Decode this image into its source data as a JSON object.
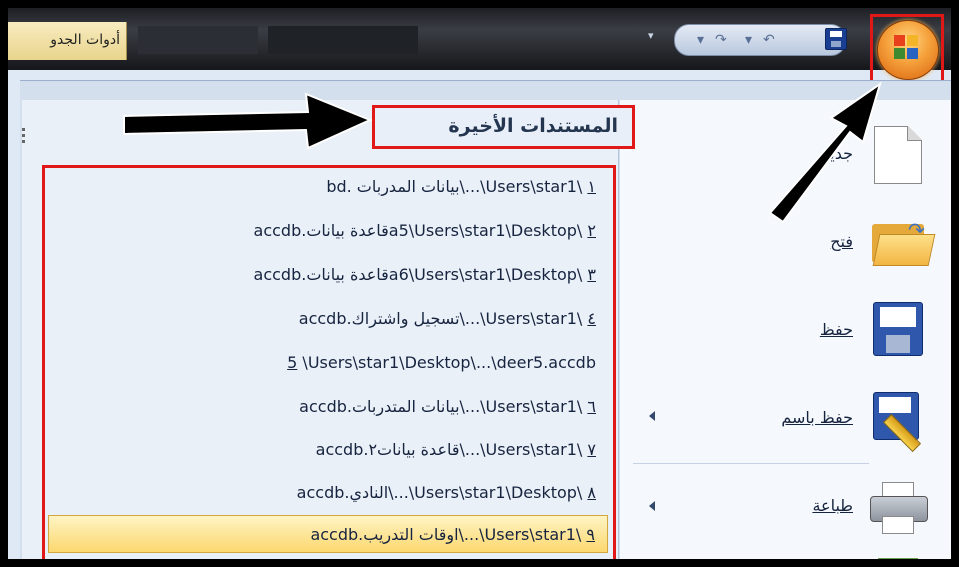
{
  "titlebar": {
    "context_tab": "أدوات الجدو",
    "qat_dropdown": "▾",
    "qat_undo": "↶",
    "qat_redo": "↷"
  },
  "office_button": {
    "icon": "office-logo-icon"
  },
  "recent": {
    "heading": "المستندات الأخيرة",
    "items": [
      {
        "num": "١",
        "text": "bd. بيانات المدربات\\...\\Users\\star1\\"
      },
      {
        "num": "٢",
        "text": "accdb.قاعدة بياناتa5\\Users\\star1\\Desktop\\"
      },
      {
        "num": "٣",
        "text": "accdb.قاعدة بياناتa6\\Users\\star1\\Desktop\\"
      },
      {
        "num": "٤",
        "text": "accdb.تسجيل واشتراك\\...\\Users\\star1\\"
      },
      {
        "num": "5",
        "text": "\\Users\\star1\\Desktop\\...\\deer5.accdb"
      },
      {
        "num": "٦",
        "text": "accdb.بيانات المتدربات\\...\\Users\\star1\\"
      },
      {
        "num": "٧",
        "text": "accdb.قاعدة بيانات٢\\...\\Users\\star1\\"
      },
      {
        "num": "٨",
        "text": "accdb.النادي\\...\\Users\\star1\\Desktop\\"
      },
      {
        "num": "٩",
        "text": "accdb.اوقات التدريب\\...\\Users\\star1\\"
      }
    ]
  },
  "commands": {
    "new": "جديد",
    "open": "فتح",
    "save": "حفظ",
    "save_as": "حفظ باسم",
    "print": "طباعة"
  }
}
